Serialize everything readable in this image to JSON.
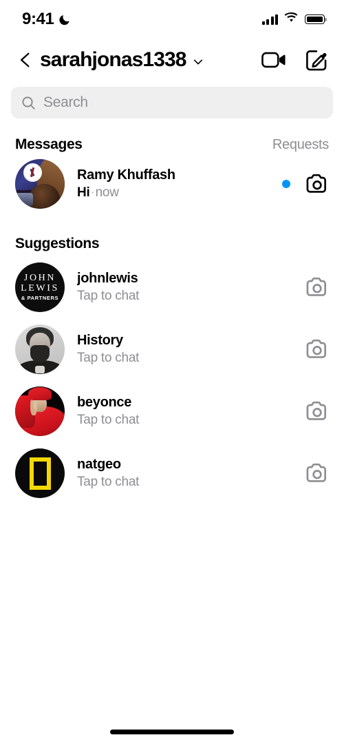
{
  "status_bar": {
    "time": "9:41",
    "dnd_icon": "crescent-moon-icon",
    "signal_icon": "cellular-signal-icon",
    "wifi_icon": "wifi-icon",
    "battery_icon": "battery-full-icon"
  },
  "header": {
    "back_icon": "chevron-left-icon",
    "username": "sarahjonas1338",
    "account_switch_icon": "chevron-down-icon",
    "video_call_icon": "video-camera-icon",
    "compose_icon": "new-message-pencil-icon"
  },
  "search": {
    "placeholder": "Search",
    "icon": "search-icon",
    "value": ""
  },
  "messages_section": {
    "title": "Messages",
    "action_label": "Requests"
  },
  "conversations": [
    {
      "name": "Ramy Khuffash",
      "preview": "Hi",
      "separator": "·",
      "time": "now",
      "unread": true,
      "camera_icon": "camera-icon",
      "avatar": "ramy-avatar"
    }
  ],
  "suggestions_section": {
    "title": "Suggestions",
    "tap_to_chat": "Tap to chat"
  },
  "suggestions": [
    {
      "name": "johnlewis",
      "subtitle": "Tap to chat",
      "camera_icon": "camera-icon",
      "avatar": "johnlewis-logo-avatar",
      "logo_lines": [
        "JOHN",
        "LEWIS",
        "& PARTNERS"
      ]
    },
    {
      "name": "History",
      "subtitle": "Tap to chat",
      "camera_icon": "camera-icon",
      "avatar": "history-portrait-avatar"
    },
    {
      "name": "beyonce",
      "subtitle": "Tap to chat",
      "camera_icon": "camera-icon",
      "avatar": "beyonce-photo-avatar"
    },
    {
      "name": "natgeo",
      "subtitle": "Tap to chat",
      "camera_icon": "camera-icon",
      "avatar": "natgeo-logo-avatar"
    }
  ],
  "colors": {
    "unread_dot": "#0095F6",
    "search_background": "#EFEFEF",
    "secondary_text": "#8E8E93",
    "natgeo_yellow": "#F6D904",
    "background": "#FFFFFF"
  },
  "home_indicator": "home-indicator"
}
